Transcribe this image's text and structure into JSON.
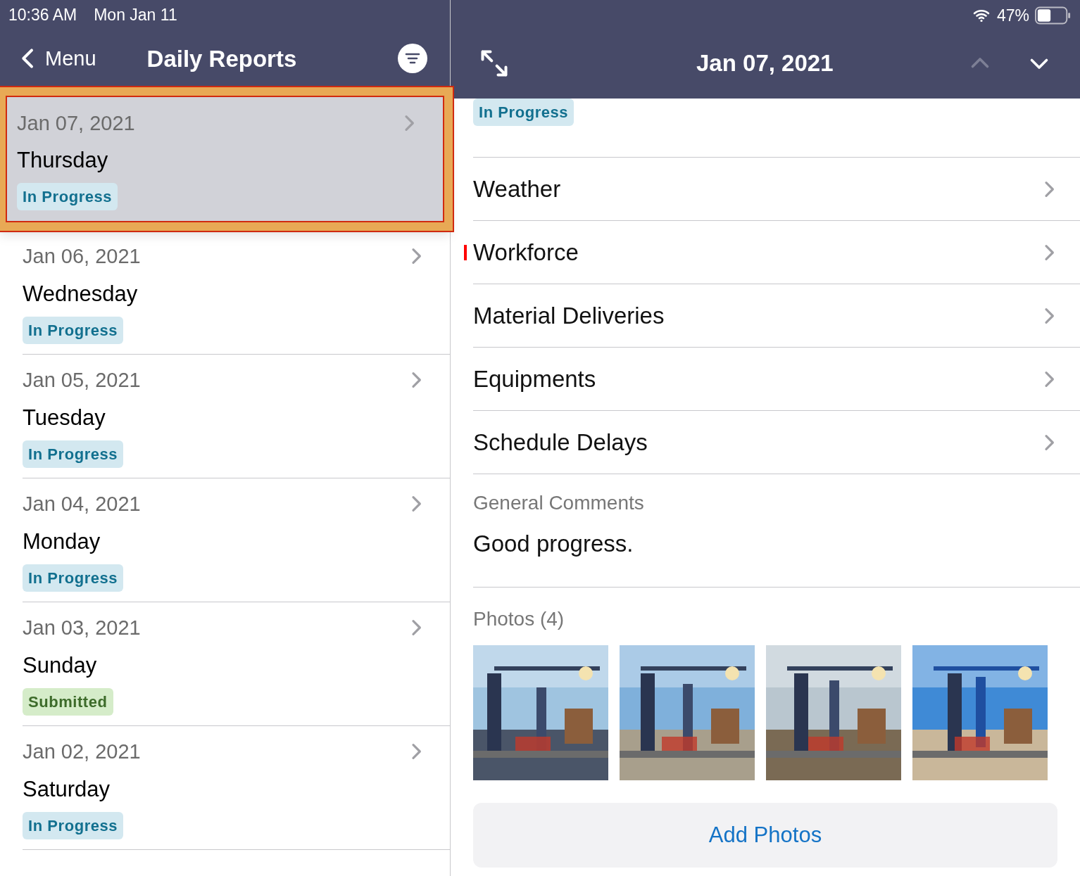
{
  "status_bar": {
    "time": "10:36 AM",
    "date": "Mon Jan 11",
    "battery": "47%"
  },
  "list_header": {
    "back_label": "Menu",
    "title": "Daily Reports"
  },
  "reports": [
    {
      "date": "Jan 07, 2021",
      "weekday": "Thursday",
      "status": {
        "label": "In Progress",
        "kind": "in_progress"
      },
      "selected": true
    },
    {
      "date": "Jan 06, 2021",
      "weekday": "Wednesday",
      "status": {
        "label": "In Progress",
        "kind": "in_progress"
      },
      "selected": false
    },
    {
      "date": "Jan 05, 2021",
      "weekday": "Tuesday",
      "status": {
        "label": "In Progress",
        "kind": "in_progress"
      },
      "selected": false
    },
    {
      "date": "Jan 04, 2021",
      "weekday": "Monday",
      "status": {
        "label": "In Progress",
        "kind": "in_progress"
      },
      "selected": false
    },
    {
      "date": "Jan 03, 2021",
      "weekday": "Sunday",
      "status": {
        "label": "Submitted",
        "kind": "submitted"
      },
      "selected": false
    },
    {
      "date": "Jan 02, 2021",
      "weekday": "Saturday",
      "status": {
        "label": "In Progress",
        "kind": "in_progress"
      },
      "selected": false
    }
  ],
  "detail": {
    "title": "Jan 07, 2021",
    "previous_disabled": true,
    "next_disabled": false,
    "status": {
      "label": "In Progress",
      "kind": "in_progress"
    },
    "sections": [
      {
        "label": "Weather",
        "required": false
      },
      {
        "label": "Workforce",
        "required": true
      },
      {
        "label": "Material Deliveries",
        "required": false
      },
      {
        "label": "Equipments",
        "required": false
      },
      {
        "label": "Schedule Delays",
        "required": false
      }
    ],
    "comments": {
      "label": "General Comments",
      "text": "Good progress."
    },
    "photos": {
      "label": "Photos (4)"
    },
    "add_button": "Add Photos"
  }
}
